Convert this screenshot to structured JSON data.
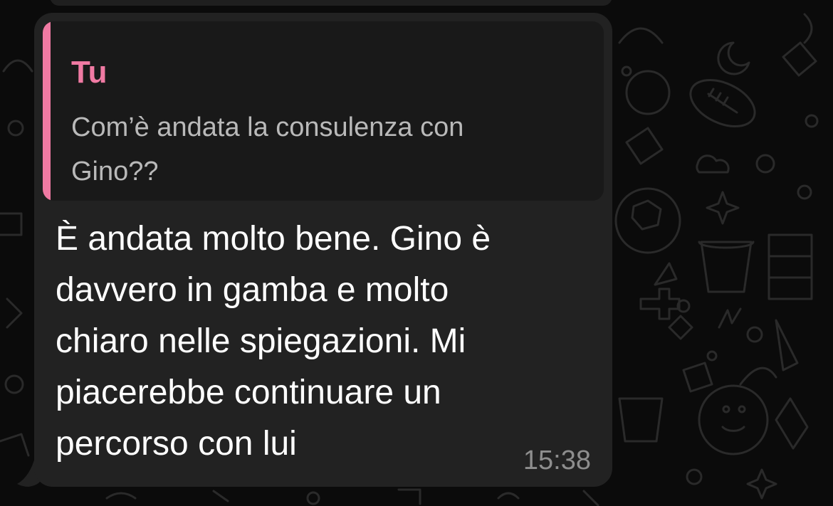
{
  "message": {
    "reply_quote": {
      "author": "Tu",
      "text": "Com’è andata la consulenza con\nGino??"
    },
    "text": "È andata molto bene. Gino è\ndavvero in gamba e molto\nchiaro nelle spiegazioni. Mi\npiacerebbe continuare un\npercorso con lui",
    "time": "15:38"
  },
  "colors": {
    "background": "#0b0b0b",
    "bubble": "#222222",
    "quote_background": "#191919",
    "quote_accent": "#f07aa3",
    "message_text": "#ffffff",
    "quote_text": "#b9b9b9",
    "timestamp": "#8e8e8e"
  },
  "icons": [
    "chat-wallpaper-doodles"
  ]
}
